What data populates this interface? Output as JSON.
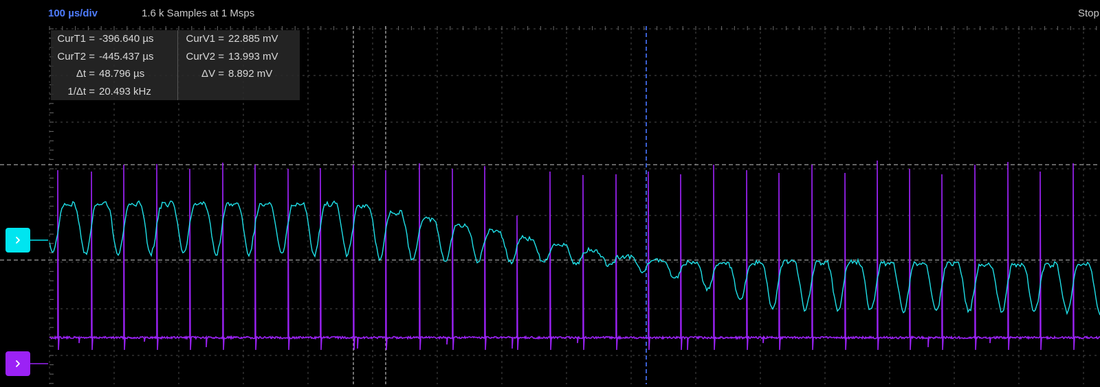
{
  "header": {
    "timebase": "100 µs/div",
    "samples": "1.6 k Samples at 1 Msps",
    "status": "Stop"
  },
  "readout": {
    "time": [
      {
        "label": "CurT1 =",
        "value": "-396.640 µs"
      },
      {
        "label": "CurT2 =",
        "value": "-445.437 µs"
      },
      {
        "label": "Δt =",
        "value": "48.796 µs"
      },
      {
        "label": "1/Δt =",
        "value": "20.493 kHz"
      }
    ],
    "voltage": [
      {
        "label": "CurV1 =",
        "value": "22.885 mV"
      },
      {
        "label": "CurV2 =",
        "value": "13.993 mV"
      },
      {
        "label": "ΔV =",
        "value": "8.892 mV"
      }
    ]
  },
  "channels": [
    {
      "color": "#00e5f0",
      "icon": "chevron-right-icon"
    },
    {
      "color": "#9b22f5",
      "icon": "chevron-right-icon"
    }
  ],
  "colors": {
    "grid": "#4a4a4a",
    "cursor_time": "#e0e0e0",
    "cursor_voltage": "#c8c8c8",
    "trigger": "#3a5fd0",
    "timebase": "#4f7dff"
  }
}
